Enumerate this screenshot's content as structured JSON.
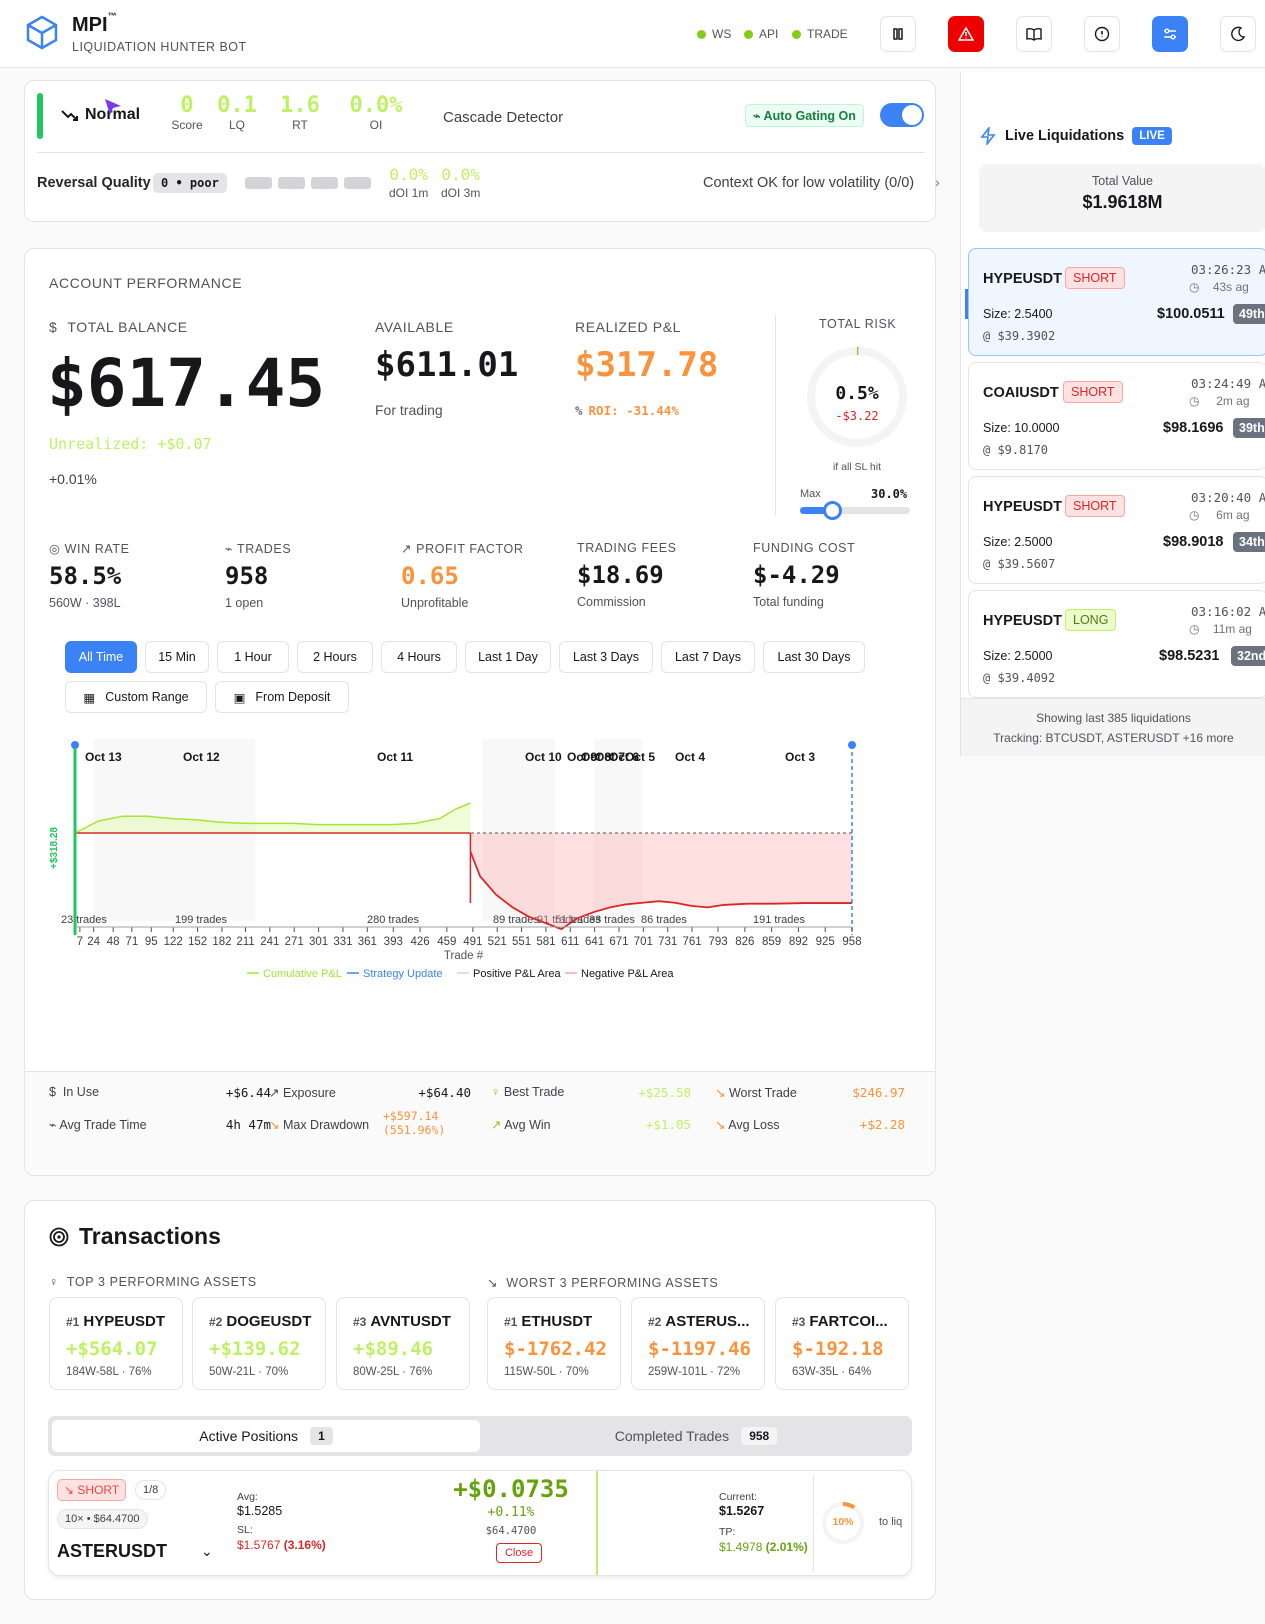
{
  "header": {
    "brand": "MPI",
    "tm": "™",
    "subtitle": "LIQUIDATION HUNTER BOT",
    "status": [
      "WS",
      "API",
      "TRADE"
    ]
  },
  "cascade": {
    "state": "Normal",
    "metrics": [
      {
        "value": "0",
        "label": "Score"
      },
      {
        "value": "0.1",
        "label": "LQ"
      },
      {
        "value": "1.6",
        "label": "RT"
      },
      {
        "value": "0.0%",
        "label": "OI"
      }
    ],
    "title": "Cascade Detector",
    "gating": "Auto Gating On",
    "rq_label": "Reversal Quality",
    "rq_badge": "0 • poor",
    "doi1_val": "0.0%",
    "doi1_lbl": "dOI 1m",
    "doi3_val": "0.0%",
    "doi3_lbl": "dOI 3m",
    "context": "Context OK for low volatility (0/0)"
  },
  "perf": {
    "title": "ACCOUNT PERFORMANCE",
    "total_label": "TOTAL BALANCE",
    "total": "$617.45",
    "unrealized": "Unrealized: +$0.07",
    "unrealized_pct": "+0.01%",
    "available_label": "AVAILABLE",
    "available": "$611.01",
    "available_sub": "For trading",
    "realized_label": "REALIZED P&L",
    "realized": "$317.78",
    "roi": "ROI: -31.44%",
    "risk_label": "TOTAL RISK",
    "risk_pct": "0.5%",
    "risk_amt": "-$3.22",
    "risk_sub": "if all SL hit",
    "max_label": "Max",
    "max_val": "30.0%",
    "max_frac": 0.3,
    "risk_frac": 0.005,
    "stats": [
      {
        "label": "WIN RATE",
        "value": "58.5%",
        "sub": "560W · 398L"
      },
      {
        "label": "TRADES",
        "value": "958",
        "sub": "1 open"
      },
      {
        "label": "PROFIT FACTOR",
        "value": "0.65",
        "sub": "Unprofitable"
      },
      {
        "label": "TRADING FEES",
        "value": "$18.69",
        "sub": "Commission"
      },
      {
        "label": "FUNDING COST",
        "value": "$-4.29",
        "sub": "Total funding"
      }
    ],
    "timeframes": [
      "All Time",
      "15 Min",
      "1 Hour",
      "2 Hours",
      "4 Hours",
      "Last 1 Day",
      "Last 3 Days",
      "Last 7 Days",
      "Last 30 Days"
    ],
    "custom_range": "Custom Range",
    "from_deposit": "From Deposit",
    "metrics": [
      {
        "label": "In Use",
        "value": "+$6.44"
      },
      {
        "label": "Exposure",
        "value": "+$64.40"
      },
      {
        "label": "Best Trade",
        "value": "+$25.58"
      },
      {
        "label": "Worst Trade",
        "value": "$246.97"
      },
      {
        "label": "Avg Trade Time",
        "value": "4h 47m"
      },
      {
        "label": "Max Drawdown",
        "value": "+$597.14",
        "value2": "(551.96%)"
      },
      {
        "label": "Avg Win",
        "value": "+$1.05"
      },
      {
        "label": "Avg Loss",
        "value": "+$2.28"
      }
    ]
  },
  "chart_data": {
    "type": "line",
    "xlabel": "Trade #",
    "x_ticks": [
      7,
      24,
      48,
      71,
      95,
      122,
      152,
      182,
      211,
      241,
      271,
      301,
      331,
      361,
      393,
      426,
      459,
      491,
      521,
      551,
      581,
      611,
      641,
      671,
      701,
      731,
      761,
      793,
      826,
      859,
      892,
      925,
      958
    ],
    "day_labels": [
      "Oct 13",
      "Oct 12",
      "Oct 11",
      "Oct 10",
      "Oct 9",
      "Oct 8",
      "Oct 7",
      "Oct 6",
      "Oct 5",
      "Oct 4",
      "Oct 3"
    ],
    "trade_counts": [
      "23 trades",
      "199 trades",
      "280 trades",
      "89 trades",
      "91 trades",
      "51 trades",
      "33 trades",
      "86 trades",
      "191 trades"
    ],
    "legend": [
      "Cumulative P&L",
      "Strategy Update",
      "Positive P&L Area",
      "Negative P&L Area"
    ],
    "y_axis_label": "+$318.28",
    "series": [
      {
        "name": "Cumulative P&L",
        "x": [
          1,
          30,
          60,
          90,
          120,
          150,
          180,
          210,
          240,
          270,
          300,
          330,
          360,
          390,
          420,
          450,
          470,
          488
        ],
        "y": [
          0,
          10,
          14,
          14,
          12,
          11,
          9,
          8,
          8,
          8,
          7,
          7,
          7,
          7,
          8,
          12,
          20,
          25
        ]
      },
      {
        "name": "Negative",
        "x": [
          488,
          500,
          520,
          540,
          560,
          580,
          600,
          620,
          640,
          660,
          680,
          700,
          720,
          740,
          760,
          780,
          800,
          830,
          860,
          900,
          958
        ],
        "y": [
          -60,
          -140,
          -200,
          -240,
          -270,
          -290,
          -310,
          -275,
          -255,
          -240,
          -230,
          -225,
          -220,
          -225,
          -235,
          -240,
          -232,
          -228,
          -228,
          -226,
          -226
        ]
      }
    ]
  },
  "live": {
    "title": "Live Liquidations",
    "badge": "LIVE",
    "total_label": "Total Value",
    "total": "$1.9618M",
    "footer1": "Showing last 385 liquidations",
    "footer2": "Tracking: BTCUSDT, ASTERUSDT +16 more",
    "items": [
      {
        "symbol": "HYPEUSDT",
        "side": "SHORT",
        "time": "03:26:23 A",
        "ago": "43s ag",
        "size": "Size: 2.5400",
        "price": "@ $39.3902",
        "value": "$100.0511",
        "rank": "49th"
      },
      {
        "symbol": "COAIUSDT",
        "side": "SHORT",
        "time": "03:24:49 A",
        "ago": "2m ag",
        "size": "Size: 10.0000",
        "price": "@ $9.8170",
        "value": "$98.1696",
        "rank": "39th"
      },
      {
        "symbol": "HYPEUSDT",
        "side": "SHORT",
        "time": "03:20:40 A",
        "ago": "6m ag",
        "size": "Size: 2.5000",
        "price": "@ $39.5607",
        "value": "$98.9018",
        "rank": "34th"
      },
      {
        "symbol": "HYPEUSDT",
        "side": "LONG",
        "time": "03:16:02 A",
        "ago": "11m ag",
        "size": "Size: 2.5000",
        "price": "@ $39.4092",
        "value": "$98.5231",
        "rank": "32nd"
      }
    ]
  },
  "tx": {
    "title": "Transactions",
    "top_label": "TOP 3 PERFORMING ASSETS",
    "worst_label": "WORST 3 PERFORMING ASSETS",
    "top": [
      {
        "rank": "#1",
        "sym": "HYPEUSDT",
        "val": "+$564.07",
        "sub": "184W-58L · 76%"
      },
      {
        "rank": "#2",
        "sym": "DOGEUSDT",
        "val": "+$139.62",
        "sub": "50W-21L · 70%"
      },
      {
        "rank": "#3",
        "sym": "AVNTUSDT",
        "val": "+$89.46",
        "sub": "80W-25L · 76%"
      }
    ],
    "worst": [
      {
        "rank": "#1",
        "sym": "ETHUSDT",
        "val": "$-1762.42",
        "sub": "115W-50L · 70%"
      },
      {
        "rank": "#2",
        "sym": "ASTERUS...",
        "val": "$-1197.46",
        "sub": "259W-101L · 72%"
      },
      {
        "rank": "#3",
        "sym": "FARTCOI...",
        "val": "$-192.18",
        "sub": "63W-35L · 64%"
      }
    ],
    "tab_active": "Active Positions",
    "tab_active_count": "1",
    "tab_completed": "Completed Trades",
    "tab_completed_count": "958",
    "pos": {
      "side": "SHORT",
      "frac": "1/8",
      "lev": "10× • $64.4700",
      "symbol": "ASTERUSDT",
      "avg_l": "Avg:",
      "avg": "$1.5285",
      "sl_l": "SL:",
      "sl": "$1.5767",
      "sl_pct": "(3.16%)",
      "pnl": "+$0.0735",
      "pnl_pct": "+0.11%",
      "notional": "$64.4700",
      "close": "Close",
      "cur_l": "Current:",
      "cur": "$1.5267",
      "tp_l": "TP:",
      "tp": "$1.4978",
      "tp_pct": "(2.01%)",
      "liq_pct": "10%",
      "liq_frac": 0.1,
      "liq_l": "to liq"
    }
  },
  "colors": {
    "green": "#84cc16",
    "orange": "#fb923c",
    "red": "#dc2626",
    "blue": "#3b82f6"
  }
}
